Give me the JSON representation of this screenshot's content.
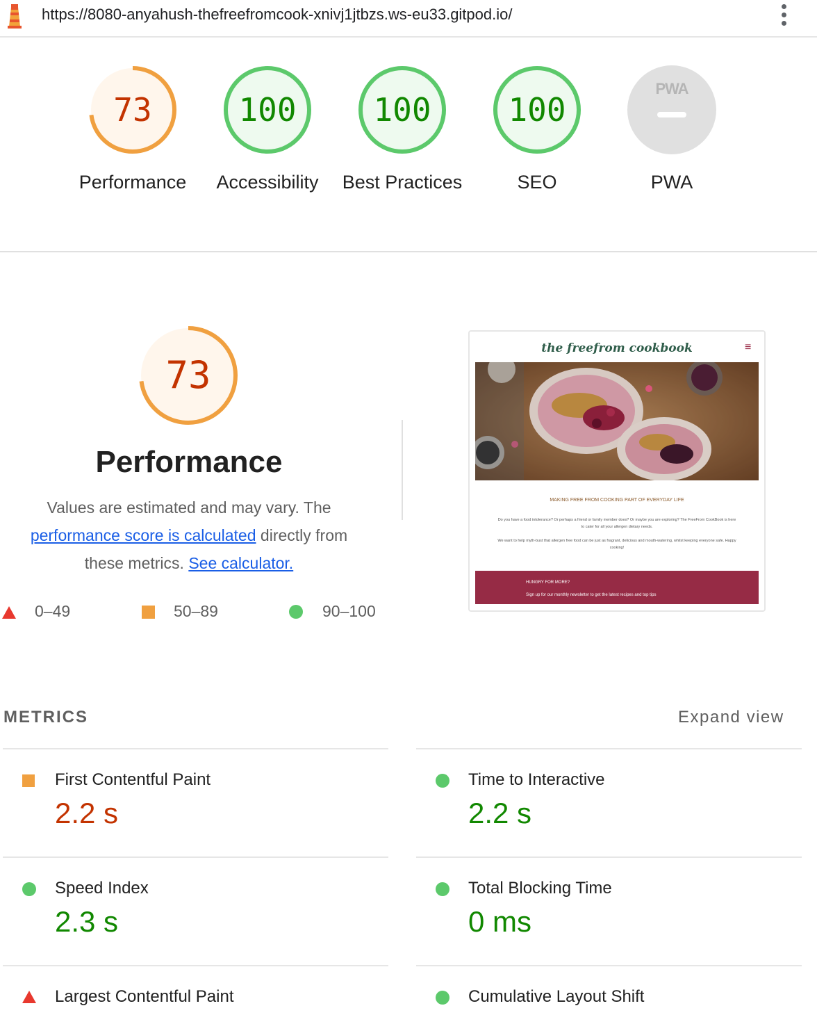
{
  "browser": {
    "url": "https://8080-anyahush-thefreefromcook-xnivj1jtbzs.ws-eu33.gitpod.io/"
  },
  "scores": [
    {
      "label": "Performance",
      "value": "73",
      "fraction": 0.73,
      "rating": "average"
    },
    {
      "label": "Accessibility",
      "value": "100",
      "fraction": 1.0,
      "rating": "pass"
    },
    {
      "label": "Best Practices",
      "value": "100",
      "fraction": 1.0,
      "rating": "pass"
    },
    {
      "label": "SEO",
      "value": "100",
      "fraction": 1.0,
      "rating": "pass"
    },
    {
      "label": "PWA",
      "badge": "PWA",
      "rating": "not-applicable"
    }
  ],
  "performance": {
    "score": "73",
    "score_fraction": 0.73,
    "title": "Performance",
    "desc_prefix": "Values are estimated and may vary. The",
    "link1": "performance score is calculated",
    "desc_mid": "directly from these metrics.",
    "link2": "See calculator.",
    "legend": [
      {
        "range": "0–49",
        "icon": "red-triangle"
      },
      {
        "range": "50–89",
        "icon": "orange-square"
      },
      {
        "range": "90–100",
        "icon": "green-circle"
      }
    ]
  },
  "screenshot": {
    "brand": "the freefrom cookbook",
    "menu_icon": "≡",
    "tagline": "MAKING FREE FROM COOKING PART OF EVERYDAY LIFE",
    "para1": "Do you have a food intolerance? Or perhaps a friend or family member does? Or maybe you are exploring? The FreeFrom CookBook is here to cater for all your allergen dietary needs.",
    "para2": "We want to help myth-bust that allergen free food can be just as fragrant, delicious and mouth-watering, whilst keeping everyone safe. Happy cooking!",
    "band_title": "HUNGRY FOR MORE?",
    "band_text": "Sign up for our monthly newsletter to get the latest recipes and top tips"
  },
  "metrics": {
    "heading": "METRICS",
    "expand_label": "Expand view",
    "items": [
      {
        "name": "First Contentful Paint",
        "value": "2.2 s",
        "rating": "average"
      },
      {
        "name": "Time to Interactive",
        "value": "2.2 s",
        "rating": "pass"
      },
      {
        "name": "Speed Index",
        "value": "2.3 s",
        "rating": "pass"
      },
      {
        "name": "Total Blocking Time",
        "value": "0 ms",
        "rating": "pass"
      },
      {
        "name": "Largest Contentful Paint",
        "value": "",
        "rating": "fail"
      },
      {
        "name": "Cumulative Layout Shift",
        "value": "",
        "rating": "pass"
      }
    ]
  },
  "colors": {
    "fail": "#e8382e",
    "average": "#f0a040",
    "average_text": "#c33300",
    "pass": "#5cc96b",
    "pass_text": "#118800",
    "link": "#1a5ee6"
  }
}
